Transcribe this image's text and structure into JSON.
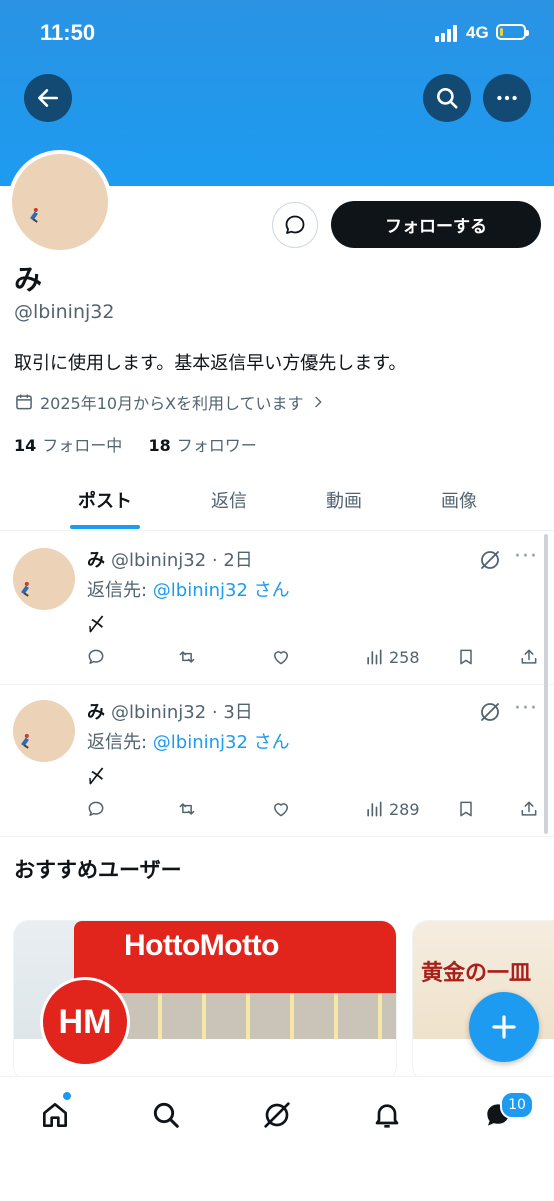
{
  "status_bar": {
    "time": "11:50",
    "network": "4G",
    "battery_percent": 12
  },
  "profile": {
    "display_name": "み",
    "handle": "@lbininj32",
    "bio": "取引に使用します。基本返信早い方優先します。",
    "joined": "2025年10月からXを利用しています",
    "following_count": "14",
    "following_label": "フォロー中",
    "followers_count": "18",
    "followers_label": "フォロワー",
    "follow_button": "フォローする"
  },
  "tabs": [
    {
      "label": "ポスト",
      "active": true
    },
    {
      "label": "返信",
      "active": false
    },
    {
      "label": "動画",
      "active": false
    },
    {
      "label": "画像",
      "active": false
    }
  ],
  "posts": [
    {
      "name": "み",
      "handle_time": "@lbininj32 · 2日",
      "reply_prefix": "返信先: ",
      "reply_handle": "@lbininj32 さん",
      "body": "〆",
      "views": "258"
    },
    {
      "name": "み",
      "handle_time": "@lbininj32 · 3日",
      "reply_prefix": "返信先: ",
      "reply_handle": "@lbininj32 さん",
      "body": "〆",
      "views": "289"
    }
  ],
  "recommended": {
    "title": "おすすめユーザー",
    "cards": [
      {
        "storefront_text": "HottoMotto",
        "logo_text": "HM"
      },
      {
        "title": "黄金の一皿"
      }
    ]
  },
  "bottom_nav": {
    "messages_badge": "10"
  },
  "colors": {
    "accent": "#1d9bf0",
    "text": "#0f1419",
    "muted": "#536471",
    "banner": "#1d9bf0"
  },
  "icons": [
    "back-arrow-icon",
    "search-icon",
    "more-icon",
    "message-icon",
    "calendar-icon",
    "chevron-right-icon",
    "grok-icon",
    "reply-icon",
    "repost-icon",
    "like-icon",
    "views-icon",
    "bookmark-icon",
    "share-icon",
    "plus-icon",
    "home-icon",
    "bell-icon",
    "mail-icon"
  ]
}
